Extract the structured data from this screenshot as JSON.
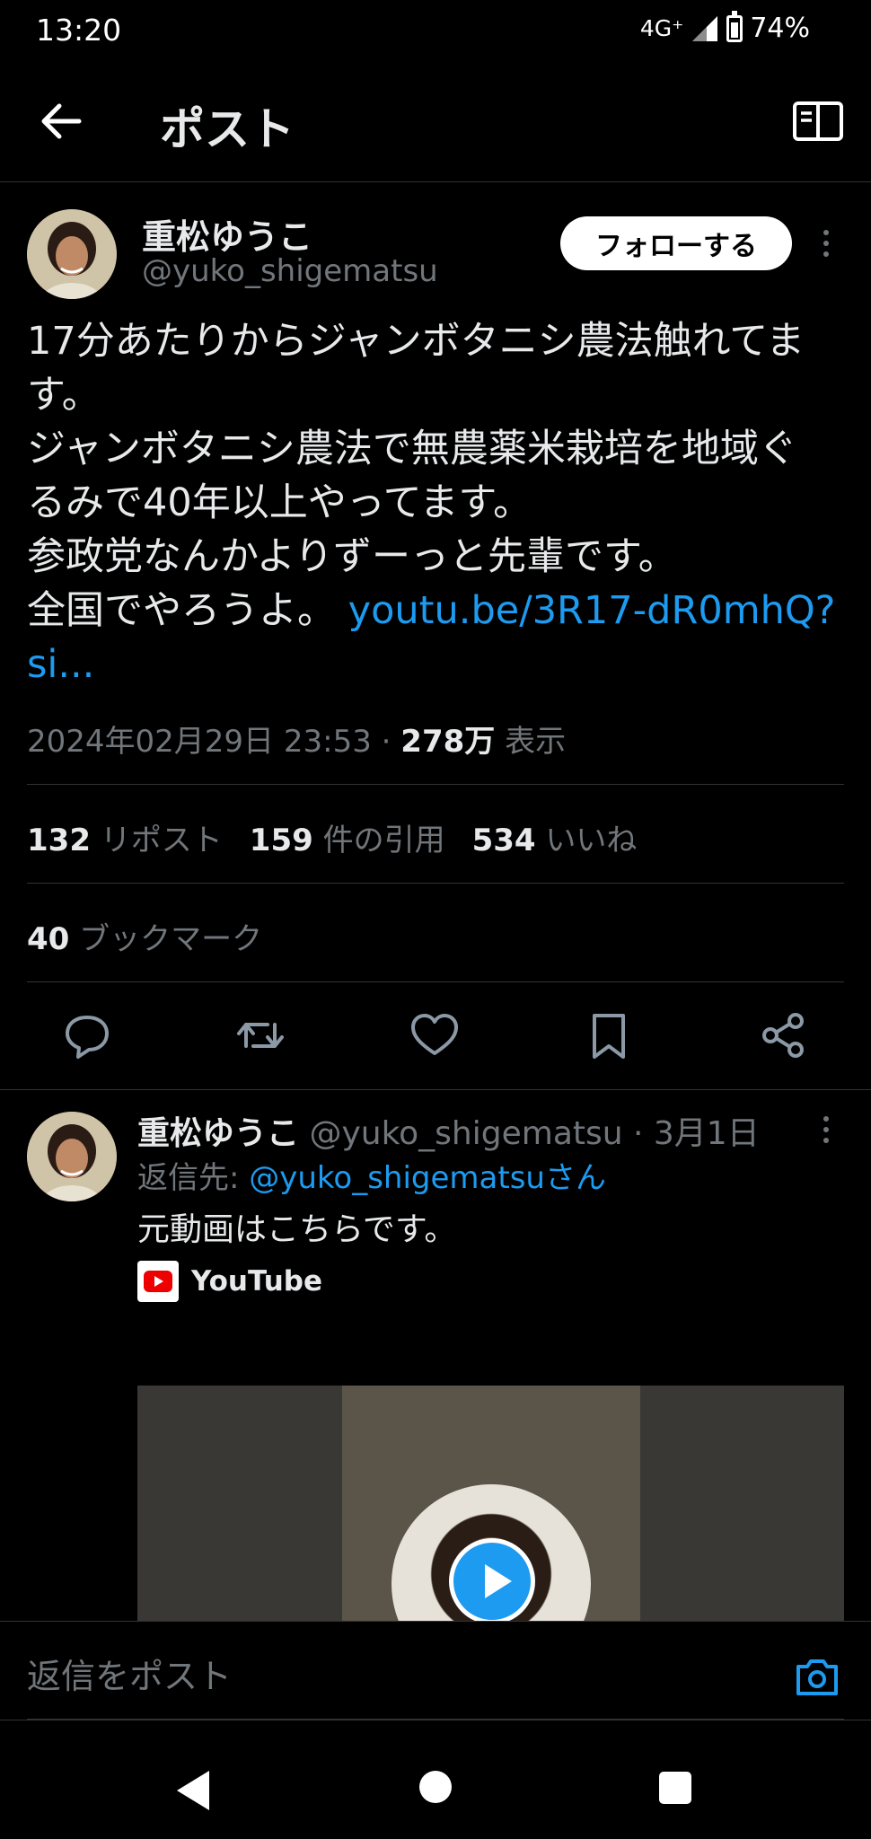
{
  "status_bar": {
    "time": "13:20",
    "network": "4G⁺",
    "battery": "74%"
  },
  "header": {
    "title": "ポスト"
  },
  "tweet": {
    "author_name": "重松ゆうこ",
    "author_handle": "@yuko_shigematsu",
    "follow_label": "フォローする",
    "lines": [
      "17分あたりからジャンボタニシ農法触れてま",
      "す。",
      "ジャンボタニシ農法で無農薬米栽培を地域ぐ",
      "るみで40年以上やってます。",
      "参政党なんかよりずーっと先輩です。"
    ],
    "last_line_text": "全国でやろうよ。 ",
    "link_part1": "youtu.be/3R17-dR0mhQ?",
    "link_part2": "si...",
    "datetime": "2024年02月29日 23:53 · ",
    "views_count": "278万",
    "views_label": " 表示",
    "reposts_count": "132",
    "reposts_label": " リポスト",
    "quotes_count": "159",
    "quotes_label": " 件の引用",
    "likes_count": "534",
    "likes_label": " いいね",
    "bookmarks_count": "40",
    "bookmarks_label": " ブックマーク"
  },
  "reply": {
    "author_name": "重松ゆうこ",
    "author_handle": " @yuko_shigematsu",
    "date": " · 3月1日",
    "reply_to_prefix": "返信先: ",
    "reply_to_handle": "@yuko_shigematsuさん",
    "text": "元動画はこちらです。",
    "card_source": "YouTube"
  },
  "reply_bar": {
    "placeholder": "返信をポスト"
  },
  "icons": {
    "back": "arrow-left-icon",
    "reader": "reader-mode-icon",
    "reply": "comment-icon",
    "retweet": "retweet-icon",
    "like": "heart-icon",
    "bookmark": "bookmark-icon",
    "share": "share-icon",
    "camera": "camera-icon"
  },
  "colors": {
    "accent": "#1d9bf0",
    "background": "#000000",
    "muted": "#71767b"
  }
}
